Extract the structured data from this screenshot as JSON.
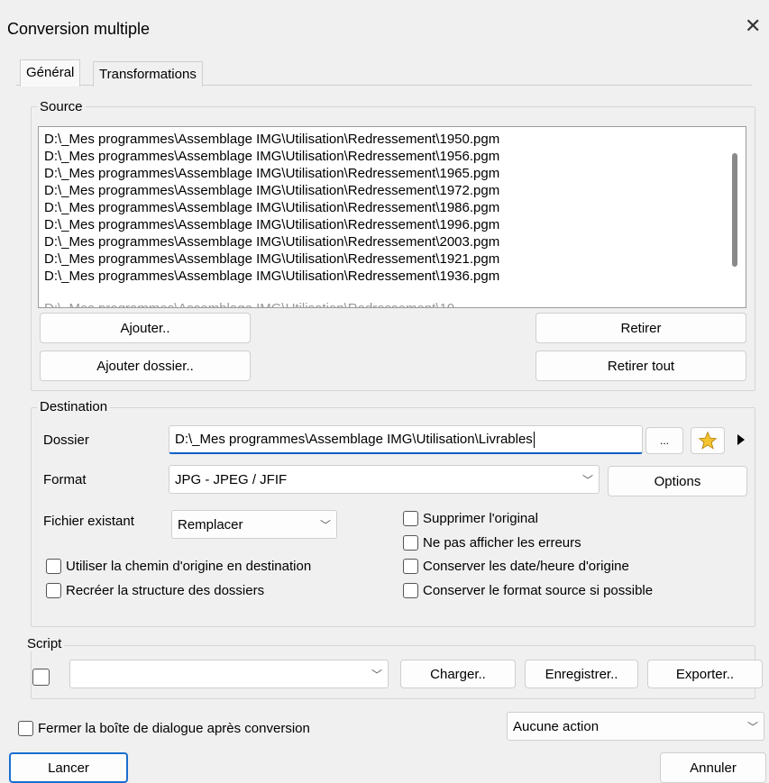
{
  "window": {
    "title": "Conversion multiple"
  },
  "tabs": [
    {
      "label": "Général",
      "active": true
    },
    {
      "label": "Transformations",
      "active": false
    }
  ],
  "source": {
    "legend": "Source",
    "files": [
      "D:\\_Mes programmes\\Assemblage IMG\\Utilisation\\Redressement\\1950.pgm",
      "D:\\_Mes programmes\\Assemblage IMG\\Utilisation\\Redressement\\1956.pgm",
      "D:\\_Mes programmes\\Assemblage IMG\\Utilisation\\Redressement\\1965.pgm",
      "D:\\_Mes programmes\\Assemblage IMG\\Utilisation\\Redressement\\1972.pgm",
      "D:\\_Mes programmes\\Assemblage IMG\\Utilisation\\Redressement\\1986.pgm",
      "D:\\_Mes programmes\\Assemblage IMG\\Utilisation\\Redressement\\1996.pgm",
      "D:\\_Mes programmes\\Assemblage IMG\\Utilisation\\Redressement\\2003.pgm",
      "D:\\_Mes programmes\\Assemblage IMG\\Utilisation\\Redressement\\1921.pgm",
      "D:\\_Mes programmes\\Assemblage IMG\\Utilisation\\Redressement\\1936.pgm"
    ],
    "add_label": "Ajouter..",
    "add_folder_label": "Ajouter dossier..",
    "remove_label": "Retirer",
    "remove_all_label": "Retirer tout"
  },
  "destination": {
    "legend": "Destination",
    "folder_label": "Dossier",
    "folder_value": "D:\\_Mes programmes\\Assemblage IMG\\Utilisation\\Livrables",
    "browse_label": "...",
    "format_label": "Format",
    "format_value": "JPG - JPEG / JFIF",
    "options_label": "Options",
    "existing_label": "Fichier existant",
    "existing_value": "Remplacer",
    "delete_original": "Supprimer l'original",
    "no_errors": "Ne pas afficher les erreurs",
    "use_origin_path": "Utiliser la chemin d'origine en destination",
    "keep_datetime": "Conserver les date/heure d'origine",
    "recreate_structure": "Recréer la structure des dossiers",
    "keep_source_format": "Conserver le format source si possible"
  },
  "script": {
    "legend": "Script",
    "value": "",
    "load_label": "Charger..",
    "save_label": "Enregistrer..",
    "export_label": "Exporter.."
  },
  "footer": {
    "close_after_label": "Fermer la boîte de dialogue après conversion",
    "action_value": "Aucune action",
    "launch_label": "Lancer",
    "cancel_label": "Annuler"
  },
  "icons": {
    "close": "close-icon",
    "star": "favorite-star-icon",
    "arrow": "play-arrow-icon",
    "chevron": "chevron-down-icon"
  },
  "colors": {
    "accent": "#0a5fc4",
    "star": "#f4c430"
  }
}
